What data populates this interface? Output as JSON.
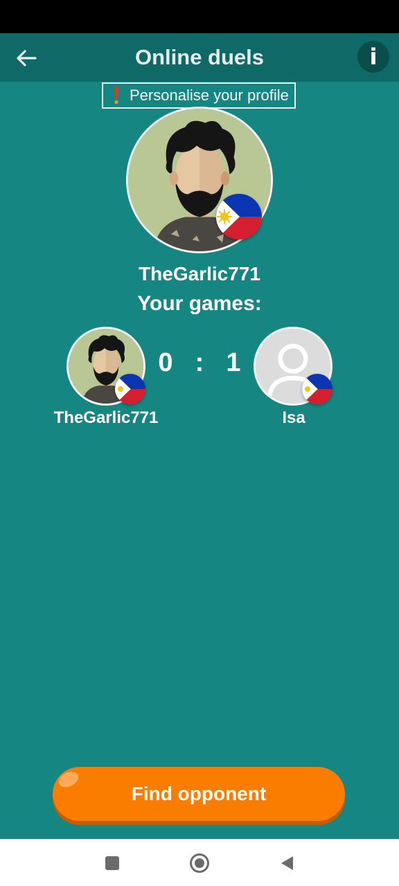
{
  "header": {
    "title": "Online duels",
    "back_icon": "arrow-left-icon",
    "info_label": "i"
  },
  "profile_prompt": {
    "icon": "exclamation-icon",
    "label": "Personalise your profile"
  },
  "player": {
    "username": "TheGarlic771",
    "avatar": "bearded-man-avatar",
    "flag": "philippines-flag-icon"
  },
  "games": {
    "heading": "Your games:",
    "left_player": "TheGarlic771",
    "left_score": "0",
    "separator": ":",
    "right_score": "1",
    "right_player": "Isa",
    "right_avatar": "default-user-avatar"
  },
  "actions": {
    "find_opponent": "Find opponent"
  },
  "colors": {
    "background": "#158682",
    "header": "#0f6966",
    "button": "#fa7d00"
  },
  "system_nav": {
    "recents_icon": "square-icon",
    "home_icon": "circle-icon",
    "back_icon": "triangle-back-icon"
  }
}
